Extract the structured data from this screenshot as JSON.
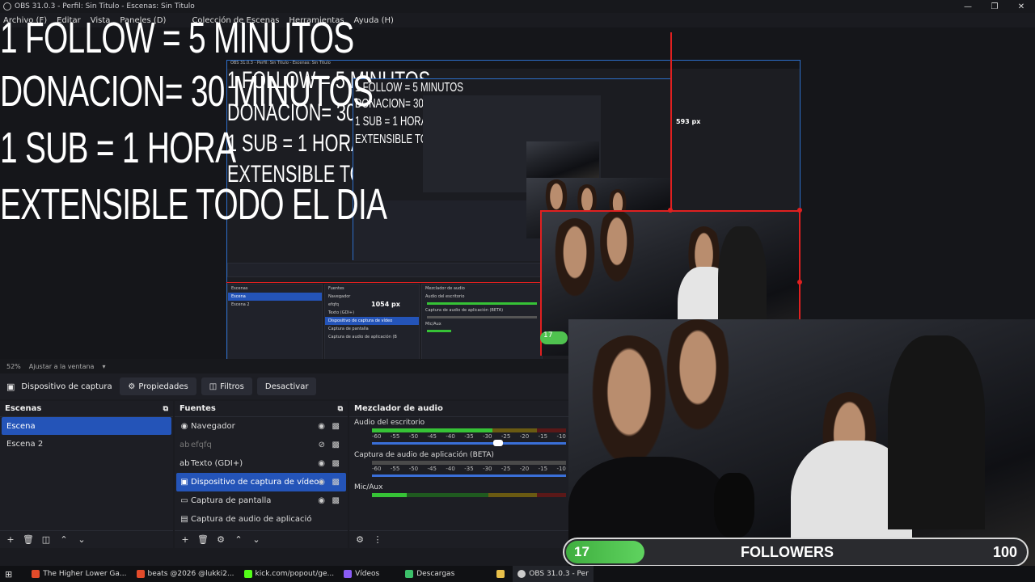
{
  "window": {
    "title": "OBS 31.0.3 - Perfil: Sin Titulo - Escenas: Sin Titulo"
  },
  "menu": [
    "Archivo (F)",
    "Editar",
    "Vista",
    "Paneles (D)",
    "Colección de Escenas",
    "Herramientas",
    "Ayuda (H)"
  ],
  "overlay_text": {
    "line1": "1 FOLLOW = 5 MINUTOS",
    "line2": "DONACION= 30 MINUTOS",
    "line3": "1 SUB = 1 HORA",
    "line4": "EXTENSIBLE TODO EL DIA"
  },
  "preview": {
    "zoom": "52%",
    "fit_label": "Ajustar a la ventana",
    "px_label_1": "593 px",
    "px_label_2": "1054 px",
    "mini_count": "17"
  },
  "source_toolbar": {
    "selected_source": "Dispositivo de captura de v",
    "properties": "Propiedades",
    "filters": "Filtros",
    "deactivate": "Desactivar"
  },
  "scenes": {
    "title": "Escenas",
    "items": [
      "Escena",
      "Escena 2"
    ]
  },
  "sources": {
    "title": "Fuentes",
    "items": [
      {
        "label": "Navegador",
        "icon": "globe-icon"
      },
      {
        "label": "efqfq",
        "icon": "text-icon"
      },
      {
        "label": "Texto (GDI+)",
        "icon": "text-icon"
      },
      {
        "label": "Dispositivo de captura de vídeo",
        "icon": "camera-icon"
      },
      {
        "label": "Captura de pantalla",
        "icon": "monitor-icon"
      },
      {
        "label": "Captura de audio de aplicación (B",
        "icon": "app-audio-icon"
      }
    ]
  },
  "mixer": {
    "title": "Mezclador de audio",
    "channels": [
      {
        "name": "Audio del escritorio",
        "level": 0.62
      },
      {
        "name": "Captura de audio de aplicación (BETA)",
        "level": 0.0
      },
      {
        "name": "Mic/Aux",
        "level": 0.18
      }
    ],
    "scale": [
      "-60",
      "-55",
      "-50",
      "-45",
      "-40",
      "-35",
      "-30",
      "-25",
      "-20",
      "-15",
      "-10"
    ]
  },
  "taskbar": [
    {
      "label": "The Higher Lower Ga...",
      "color": "#e34b2a"
    },
    {
      "label": "beats @2026 @lukki2...",
      "color": "#e34b2a"
    },
    {
      "label": "kick.com/popout/ge...",
      "color": "#53fc18"
    },
    {
      "label": "Vídeos",
      "color": "#8a5cf5"
    },
    {
      "label": "Descargas",
      "color": "#3cc06a"
    },
    {
      "label": "OBS 31.0.3 - Per",
      "color": "#cccccc"
    }
  ],
  "followers": {
    "current": "17",
    "label": "FOLLOWERS",
    "goal": "100",
    "progress": 0.17
  }
}
